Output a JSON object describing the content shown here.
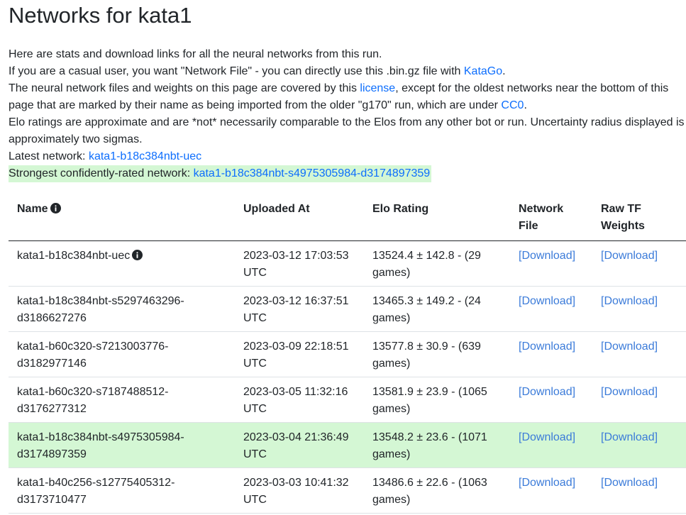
{
  "page_title": "Networks for kata1",
  "intro": {
    "line1": "Here are stats and download links for all the neural networks from this run.",
    "line2_pre": "If you are a casual user, you want \"Network File\" - you can directly use this .bin.gz file with ",
    "line2_link": "KataGo",
    "line2_post": ".",
    "line3_pre": "The neural network files and weights on this page are covered by this ",
    "line3_link": "license",
    "line3_mid": ", except for the oldest networks near the bottom of this page that are marked by their name as being imported from the older \"g170\" run, which are under ",
    "line3_link2": "CC0",
    "line3_post": ".",
    "line4": "Elo ratings are approximate and are *not* necessarily comparable to the Elos from any other bot or run. Uncertainty radius displayed is approximately two sigmas.",
    "latest_label": "Latest network: ",
    "latest_link": "kata1-b18c384nbt-uec",
    "strongest_label": "Strongest confidently-rated network: ",
    "strongest_link": "kata1-b18c384nbt-s4975305984-d3174897359"
  },
  "table": {
    "headers": {
      "name": "Name",
      "uploaded": "Uploaded At",
      "elo": "Elo Rating",
      "file": "Network File",
      "weights": "Raw TF Weights"
    },
    "download_label": "[Download]",
    "rows": [
      {
        "name": "kata1-b18c384nbt-uec",
        "has_info": true,
        "uploaded": "2023-03-12 17:03:53 UTC",
        "elo": "13524.4 ± 142.8 - (29 games)",
        "highlight": false
      },
      {
        "name": "kata1-b18c384nbt-s5297463296-d3186627276",
        "has_info": false,
        "uploaded": "2023-03-12 16:37:51 UTC",
        "elo": "13465.3 ± 149.2 - (24 games)",
        "highlight": false
      },
      {
        "name": "kata1-b60c320-s7213003776-d3182977146",
        "has_info": false,
        "uploaded": "2023-03-09 22:18:51 UTC",
        "elo": "13577.8 ± 30.9 - (639 games)",
        "highlight": false
      },
      {
        "name": "kata1-b60c320-s7187488512-d3176277312",
        "has_info": false,
        "uploaded": "2023-03-05 11:32:16 UTC",
        "elo": "13581.9 ± 23.9 - (1065 games)",
        "highlight": false
      },
      {
        "name": "kata1-b18c384nbt-s4975305984-d3174897359",
        "has_info": false,
        "uploaded": "2023-03-04 21:36:49 UTC",
        "elo": "13548.2 ± 23.6 - (1071 games)",
        "highlight": true
      },
      {
        "name": "kata1-b40c256-s12775405312-d3173710477",
        "has_info": false,
        "uploaded": "2023-03-03 10:41:32 UTC",
        "elo": "13486.6 ± 22.6 - (1063 games)",
        "highlight": false
      }
    ]
  },
  "colors": {
    "link": "#0d6efd",
    "highlight": "#d4f7d4",
    "text": "#212529"
  }
}
